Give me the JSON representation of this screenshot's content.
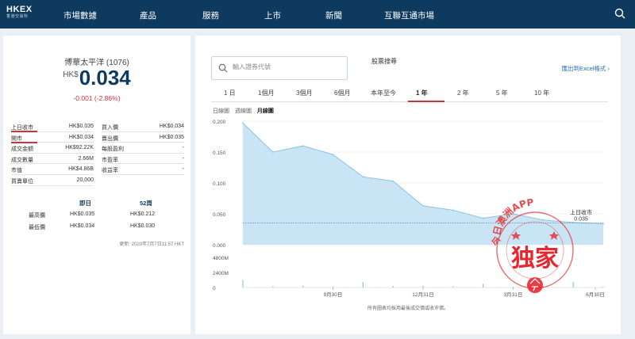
{
  "nav": {
    "logo_main": "HKEX",
    "logo_sub": "香港交易所",
    "items": [
      "市場數據",
      "產品",
      "服務",
      "上市",
      "新聞",
      "互聯互通市場"
    ]
  },
  "quote": {
    "name": "博華太平洋 (1076)",
    "currency": "HK$",
    "price": "0.034",
    "change": "-0.001 (-2.86%)",
    "left_rows": [
      {
        "label": "上日收市",
        "value": "HK$0.035"
      },
      {
        "label": "開市",
        "value": "HK$0.034"
      },
      {
        "label": "成交金額",
        "value": "HK$92.22K"
      },
      {
        "label": "成交數量",
        "value": "2.66M"
      },
      {
        "label": "市值",
        "value": "HK$4.86B"
      },
      {
        "label": "買賣單位",
        "value": "20,000"
      }
    ],
    "right_rows": [
      {
        "label": "買入價",
        "value": "HK$0.034"
      },
      {
        "label": "賣出價",
        "value": "HK$0.035"
      },
      {
        "label": "每股盈利",
        "value": "-"
      },
      {
        "label": "市盈率",
        "value": "-"
      },
      {
        "label": "收益率",
        "value": "-"
      }
    ],
    "hilo": {
      "col_today": "即日",
      "col_52w": "52周",
      "high_label": "最高價",
      "low_label": "最低價",
      "today_high": "HK$0.035",
      "today_low": "HK$0.034",
      "w52_high": "HK$0.212",
      "w52_low": "HK$0.030"
    },
    "updated": "更新: 2020年7月7日11:57 HKT"
  },
  "search": {
    "placeholder": "輸入證券代號",
    "advanced": "股票搜尋",
    "export": "匯出到Excel格式"
  },
  "periods": [
    "1 日",
    "1個月",
    "3個月",
    "6個月",
    "本年至今",
    "1 年",
    "2 年",
    "5 年",
    "10 年"
  ],
  "active_period": "1 年",
  "chart_types": [
    "日線圖",
    "週線圖",
    "月線圖"
  ],
  "active_chart_type": "月線圖",
  "chart_data": {
    "type": "area",
    "x": [
      "2019-07",
      "2019-08",
      "2019-09",
      "2019-10",
      "2019-11",
      "2019-12",
      "2020-01",
      "2020-02",
      "2020-03",
      "2020-04",
      "2020-05",
      "2020-06",
      "2020-07"
    ],
    "series": [
      {
        "values": [
          0.197,
          0.15,
          0.16,
          0.146,
          0.11,
          0.103,
          0.063,
          0.056,
          0.043,
          0.05,
          0.04,
          0.036,
          0.034
        ]
      }
    ],
    "ylim": [
      0,
      0.2
    ],
    "yticks": [
      "0.200",
      "0.150",
      "0.100",
      "0.050",
      "0.000"
    ],
    "xticks": [
      "9月30日",
      "12月31日",
      "3月31日",
      "6月30日"
    ],
    "prev_close_label": "上日收市",
    "prev_close_value": "0.035",
    "volume_ylim": [
      0,
      4800000
    ],
    "volume_yticks": [
      "4800M",
      "2400M",
      "0"
    ],
    "volume_values": [
      1200000,
      200000,
      300000,
      200000,
      900000,
      250000,
      300000,
      200000,
      600000,
      150000,
      250000,
      900000,
      150000
    ],
    "grid": true
  },
  "footnote": "所有圖表均採用最後成交價或收市價。",
  "watermark": {
    "arc_text": "今日澳洲APP",
    "big_text": "独家"
  },
  "colors": {
    "nav_bg": "#0f3a5f",
    "accent_red": "#d0313b",
    "area_fill": "#c9e4f4",
    "line": "#8cc4e3",
    "link_blue": "#1e6fb5"
  }
}
